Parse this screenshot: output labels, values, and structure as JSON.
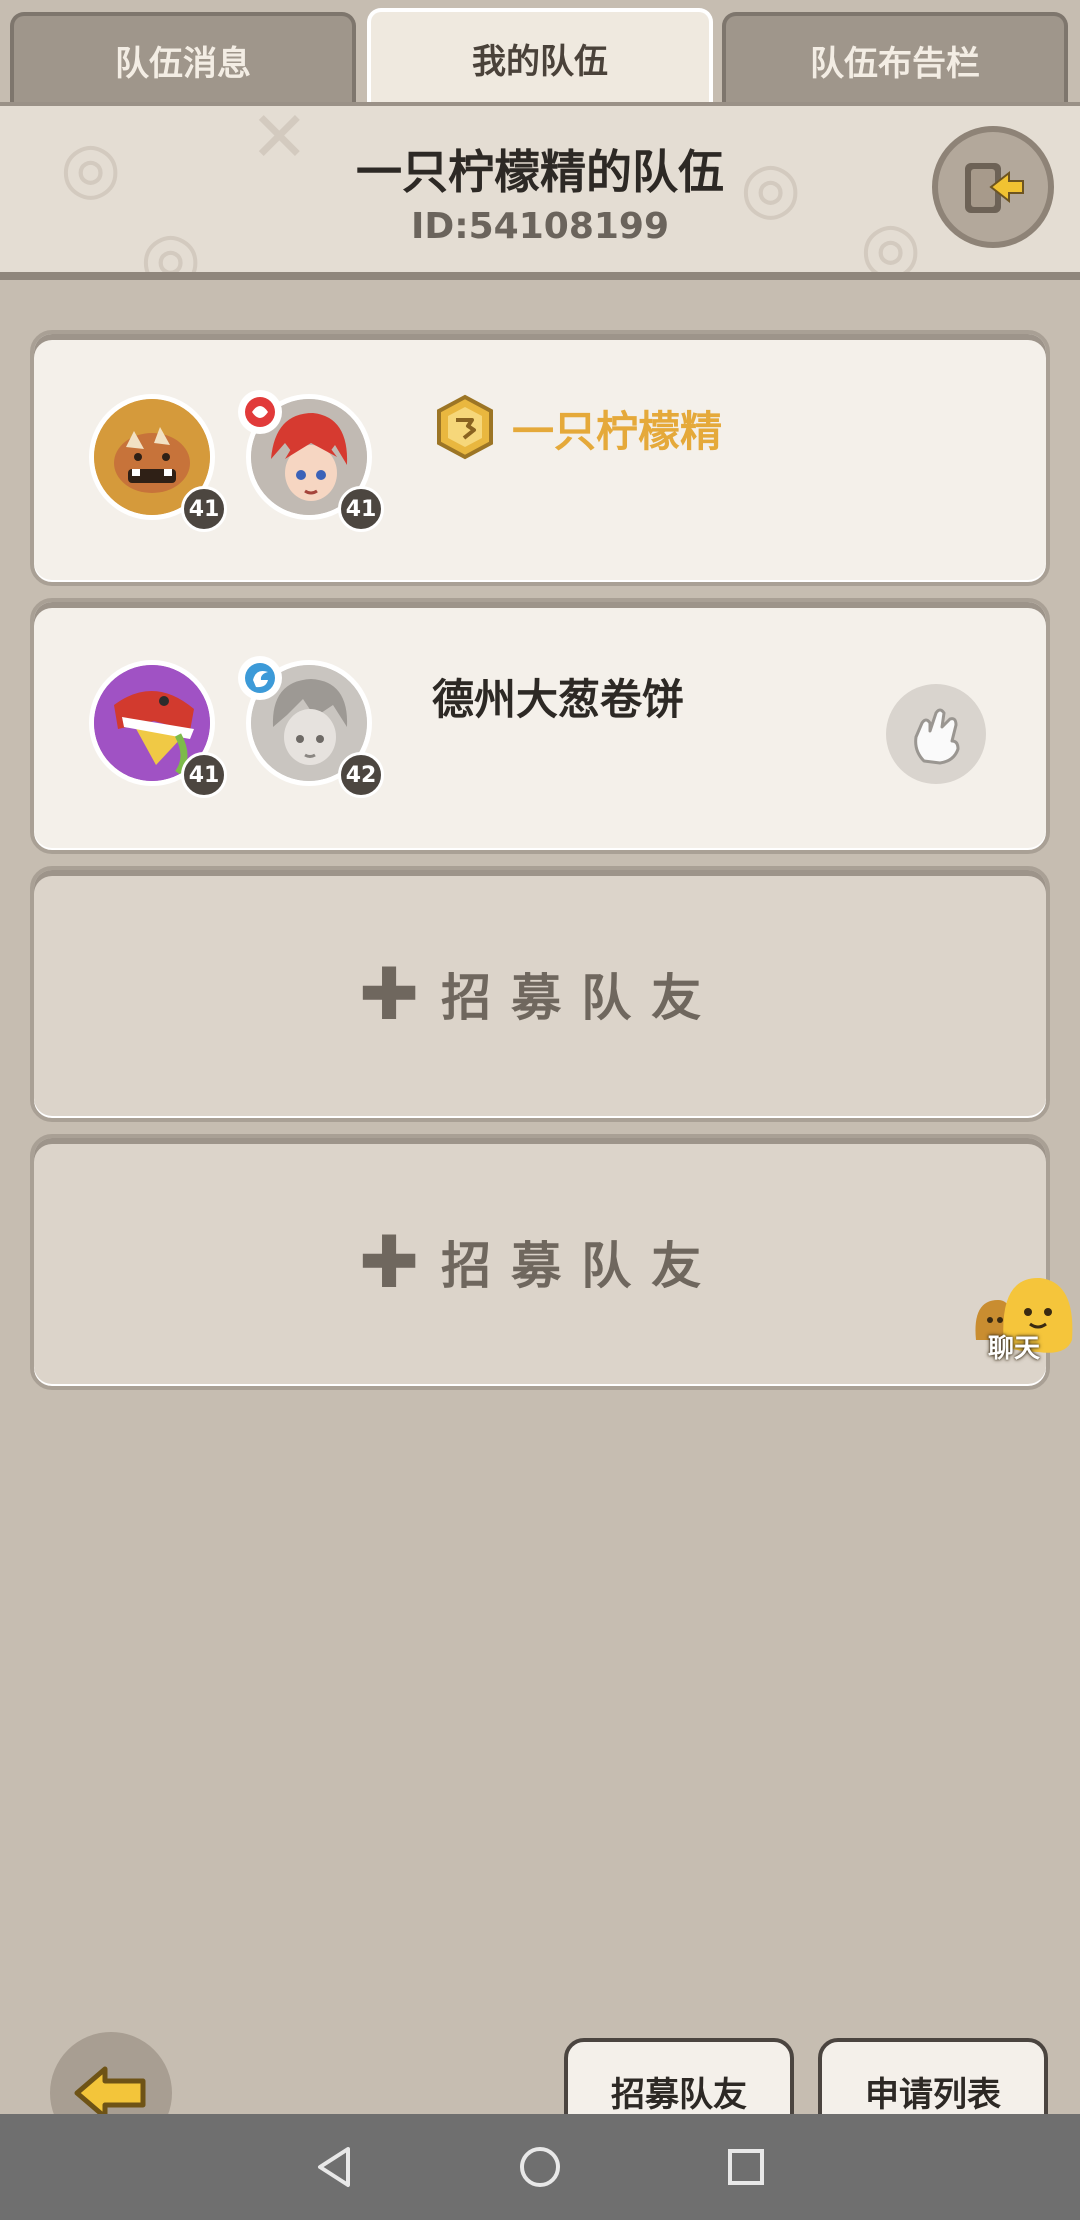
{
  "tabs": [
    {
      "label": "队伍消息",
      "active": false
    },
    {
      "label": "我的队伍",
      "active": true
    },
    {
      "label": "队伍布告栏",
      "active": false
    }
  ],
  "header": {
    "team_name": "一只柠檬精的队伍",
    "team_id": "ID:54108199"
  },
  "members": [
    {
      "name": "一只柠檬精",
      "pet_level": "41",
      "char_level": "41",
      "is_leader": true
    },
    {
      "name": "德州大葱卷饼",
      "pet_level": "41",
      "char_level": "42",
      "is_leader": false
    }
  ],
  "recruit_slots": [
    {
      "label": "招募队友"
    },
    {
      "label": "招募队友"
    }
  ],
  "chat": {
    "label": "聊天"
  },
  "bottom": {
    "recruit_button": "招募队友",
    "apply_list_button": "申请列表"
  },
  "colors": {
    "leader_name": "#e5a93a",
    "background": "#c6bdb1",
    "accent_gold": "#e9b73f"
  }
}
